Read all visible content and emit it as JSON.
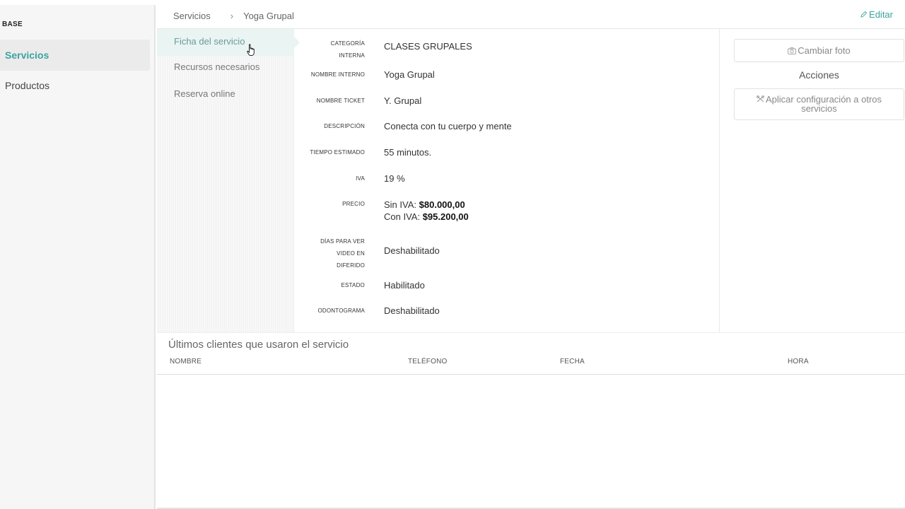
{
  "sidebar": {
    "section_title": "BASE",
    "items": [
      {
        "label": "Servicios",
        "active": true
      },
      {
        "label": "Productos",
        "active": false
      }
    ]
  },
  "header": {
    "breadcrumb": [
      "Servicios",
      "Yoga Grupal"
    ],
    "separator": "›",
    "edit_label": "Editar"
  },
  "subnav": {
    "items": [
      {
        "label": "Ficha del servicio",
        "active": true
      },
      {
        "label": "Recursos necesarios",
        "active": false
      },
      {
        "label": "Reserva online",
        "active": false
      }
    ]
  },
  "details": {
    "categoria": {
      "label_1": "CATEGORÍA",
      "label_2": "INTERNA",
      "value": "CLASES GRUPALES"
    },
    "nombre_interno": {
      "label": "NOMBRE INTERNO",
      "value": "Yoga Grupal"
    },
    "nombre_ticket": {
      "label": "NOMBRE TICKET",
      "value": "Y. Grupal"
    },
    "descripcion": {
      "label": "DESCRIPCIÓN",
      "value": "Conecta con tu cuerpo y mente"
    },
    "tiempo": {
      "label": "TIEMPO ESTIMADO",
      "value": "55 minutos."
    },
    "iva": {
      "label": "IVA",
      "value": "19 %"
    },
    "precio": {
      "label": "PRECIO",
      "sin_iva_label": "Sin IVA:",
      "sin_iva_value": "$80.000,00",
      "con_iva_label": "Con IVA:",
      "con_iva_value": "$95.200,00"
    },
    "dias_video": {
      "label_1": "DÍAS PARA VER",
      "label_2": "VIDEO EN",
      "label_3": "DIFERIDO",
      "value": "Deshabilitado"
    },
    "estado": {
      "label": "ESTADO",
      "value": "Habilitado"
    },
    "odontograma": {
      "label": "ODONTOGRAMA",
      "value": "Deshabilitado"
    }
  },
  "right_panel": {
    "change_photo_label": "Cambiar foto",
    "actions_title": "Acciones",
    "apply_config_label_1": "Aplicar configuración a otros",
    "apply_config_label_2": "servicios"
  },
  "clients": {
    "title": "Últimos clientes que usaron el servicio",
    "columns": [
      "NOMBRE",
      "TELÉFONO",
      "FECHA",
      "HORA"
    ],
    "rows": []
  },
  "colors": {
    "accent": "#3aa3a0",
    "sidebar_bg": "#f6f6f6",
    "active_subnav_bg": "#e9f4f3"
  },
  "icons": {
    "edit": "pencil-icon",
    "photo": "camera-icon",
    "apply": "tools-icon",
    "cursor": "hand-pointer-icon"
  }
}
